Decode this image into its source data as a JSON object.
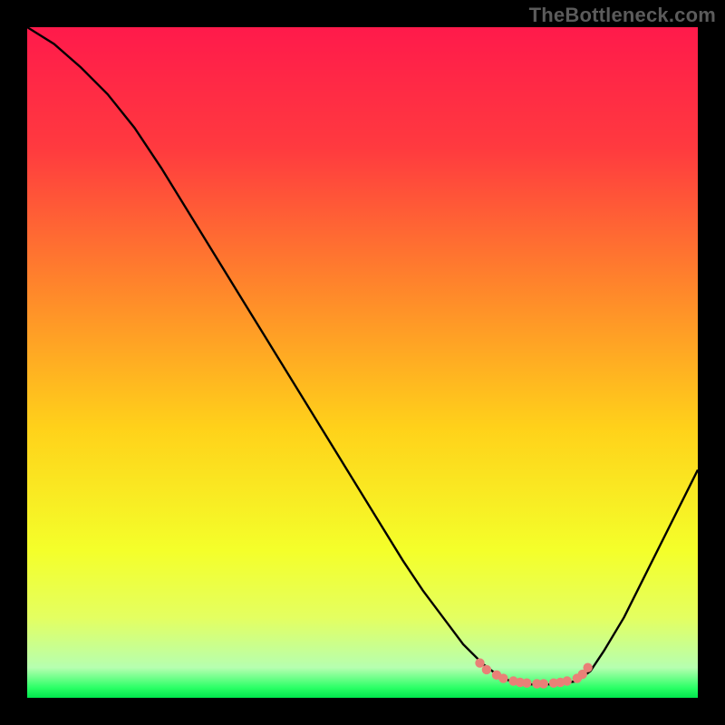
{
  "attribution": "TheBottleneck.com",
  "chart_data": {
    "type": "line",
    "title": "",
    "xlabel": "",
    "ylabel": "",
    "xlim": [
      0,
      100
    ],
    "ylim": [
      0,
      100
    ],
    "gradient_stops": [
      {
        "offset": 0.0,
        "color": "#ff1a4b"
      },
      {
        "offset": 0.18,
        "color": "#ff3a3f"
      },
      {
        "offset": 0.4,
        "color": "#ff8a2a"
      },
      {
        "offset": 0.6,
        "color": "#ffd21a"
      },
      {
        "offset": 0.78,
        "color": "#f4ff2a"
      },
      {
        "offset": 0.88,
        "color": "#e4ff60"
      },
      {
        "offset": 0.955,
        "color": "#b6ffb0"
      },
      {
        "offset": 0.985,
        "color": "#2bff66"
      },
      {
        "offset": 1.0,
        "color": "#00e64d"
      }
    ],
    "series": [
      {
        "name": "bottleneck_curve",
        "x": [
          0.0,
          4.0,
          8.0,
          12.0,
          16.0,
          20.0,
          24.0,
          28.0,
          32.0,
          36.0,
          40.0,
          44.0,
          48.0,
          52.0,
          56.0,
          59.0,
          62.0,
          65.0,
          68.0,
          70.0,
          72.0,
          74.0,
          76.0,
          79.0,
          82.0,
          84.0,
          86.0,
          89.0,
          92.0,
          96.0,
          100.0
        ],
        "y": [
          100.0,
          97.5,
          94.0,
          90.0,
          85.0,
          79.0,
          72.5,
          66.0,
          59.5,
          53.0,
          46.5,
          40.0,
          33.5,
          27.0,
          20.5,
          16.0,
          12.0,
          8.0,
          5.0,
          3.5,
          2.5,
          2.0,
          2.0,
          2.0,
          2.5,
          4.0,
          7.0,
          12.0,
          18.0,
          26.0,
          34.0
        ]
      },
      {
        "name": "optimal_zone_markers",
        "x": [
          67.5,
          68.5,
          70.0,
          71.0,
          72.5,
          73.5,
          74.5,
          76.0,
          77.0,
          78.5,
          79.5,
          80.5,
          82.0,
          82.8,
          83.6
        ],
        "y": [
          5.2,
          4.2,
          3.4,
          2.9,
          2.5,
          2.3,
          2.2,
          2.1,
          2.1,
          2.2,
          2.3,
          2.5,
          2.9,
          3.5,
          4.5
        ]
      }
    ],
    "accent_color": "#e98077",
    "curve_color": "#000000"
  }
}
